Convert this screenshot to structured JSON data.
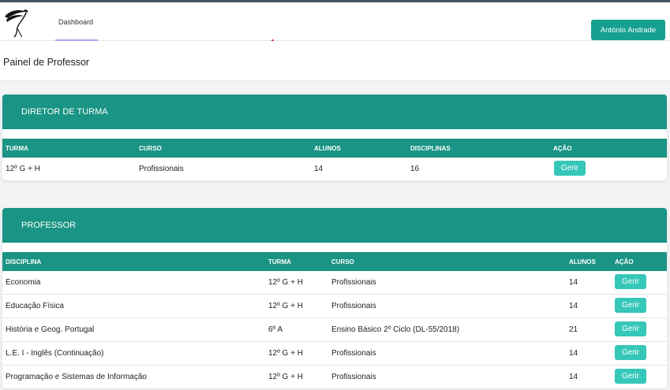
{
  "navbar": {
    "dashboard_label": "Dashboard",
    "user_name": "António Andrade"
  },
  "page": {
    "title": "Painel de Professor"
  },
  "colors": {
    "accent": "#1a9484",
    "button": "#35c7b8",
    "user_button": "#16a090"
  },
  "diretor_turma": {
    "title": "DIRETOR DE TURMA",
    "columns": [
      "TURMA",
      "CURSO",
      "ALUNOS",
      "DISCIPLINAS",
      "AÇÃO"
    ],
    "rows": [
      {
        "turma": "12º G + H",
        "curso": "Profissionais",
        "alunos": "14",
        "disciplinas": "16",
        "acao": "Gerir"
      }
    ]
  },
  "professor": {
    "title": "PROFESSOR",
    "columns": [
      "DISCIPLINA",
      "TURMA",
      "CURSO",
      "ALUNOS",
      "AÇÃO"
    ],
    "rows": [
      {
        "disciplina": "Economia",
        "turma": "12º G + H",
        "curso": "Profissionais",
        "alunos": "14",
        "acao": "Gerir"
      },
      {
        "disciplina": "Educação Física",
        "turma": "12º G + H",
        "curso": "Profissionais",
        "alunos": "14",
        "acao": "Gerir"
      },
      {
        "disciplina": "História e Geog. Portugal",
        "turma": "6º A",
        "curso": "Ensino Básico 2º Ciclo (DL-55/2018)",
        "alunos": "21",
        "acao": "Gerir"
      },
      {
        "disciplina": "L.E. I - Inglês (Continuação)",
        "turma": "12º G + H",
        "curso": "Profissionais",
        "alunos": "14",
        "acao": "Gerir"
      },
      {
        "disciplina": "Programação e Sistemas de Informação",
        "turma": "12º G + H",
        "curso": "Profissionais",
        "alunos": "14",
        "acao": "Gerir"
      }
    ]
  }
}
